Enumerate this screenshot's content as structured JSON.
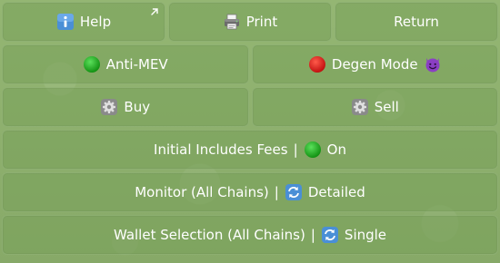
{
  "keyboard": {
    "help_label": "Help",
    "print_label": "Print",
    "return_label": "Return",
    "anti_mev_label": "Anti-MEV",
    "degen_mode_label": "Degen Mode",
    "buy_label": "Buy",
    "sell_label": "Sell",
    "initial_includes_fees": {
      "label": "Initial Includes Fees",
      "separator": "|",
      "value": "On"
    },
    "monitor": {
      "label": "Monitor (All Chains)",
      "separator": "|",
      "value": "Detailed"
    },
    "wallet_selection": {
      "label": "Wallet Selection (All Chains)",
      "separator": "|",
      "value": "Single"
    }
  },
  "icons": {
    "help": "info-icon",
    "print": "printer-icon",
    "anti_mev": "green-circle-icon",
    "degen_mode_status": "red-circle-icon",
    "degen_mode_emoji": "smiling-devil-icon",
    "buy": "gear-icon",
    "sell": "gear-icon",
    "fees": "green-circle-icon",
    "monitor": "cycle-icon",
    "wallet": "cycle-icon"
  },
  "colors": {
    "green_status": "#1fa31f",
    "red_status": "#d01818",
    "devil_purple": "#8b3fc4",
    "info_blue": "#4a8fd6",
    "button_text": "#ffffff"
  }
}
